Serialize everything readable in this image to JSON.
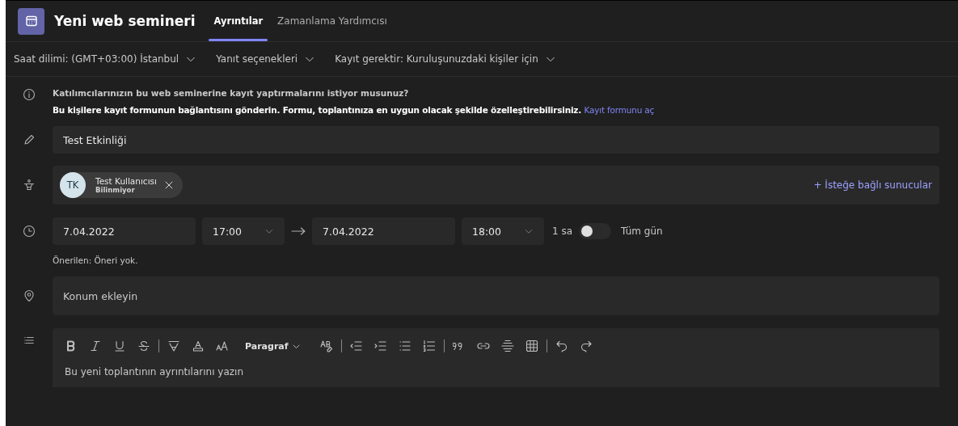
{
  "window": {
    "title": "Yeni web semineri"
  },
  "tabs": [
    {
      "label": "Ayrıntılar",
      "selected": true
    },
    {
      "label": "Zamanlama Yardımcısı",
      "selected": false
    }
  ],
  "options": [
    {
      "label": "Saat dilimi: (GMT+03:00) İstanbul"
    },
    {
      "label": "Yanıt seçenekleri"
    },
    {
      "label": "Kayıt gerektir: Kuruluşunuzdaki kişiler için"
    }
  ],
  "registration_notice": {
    "question": "Katılımcılarınızın bu web seminerine kayıt yaptırmalarını istiyor musunuz?",
    "description": "Bu kişilere kayıt formunun bağlantısını gönderin. Formu, toplantınıza en uygun olacak şekilde özelleştirebilirsiniz.",
    "link": "Kayıt formunu aç"
  },
  "title_field": {
    "value": "Test Etkinliği"
  },
  "presenters": [
    {
      "initials": "TK",
      "name": "Test Kullanıcısı",
      "status": "Bilinmiyor"
    }
  ],
  "optional_presenters_link": "+ İsteğe bağlı sunucular",
  "schedule": {
    "start_date": "7.04.2022",
    "start_time": "17:00",
    "end_date": "7.04.2022",
    "end_time": "18:00",
    "duration": "1 sa",
    "all_day": {
      "label": "Tüm gün",
      "on": false
    },
    "suggestion": "Önerilen: Öneri yok."
  },
  "location_field": {
    "placeholder": "Konum ekleyin"
  },
  "editor": {
    "toolbar": [
      {
        "kind": "bold"
      },
      {
        "kind": "italic"
      },
      {
        "kind": "underline"
      },
      {
        "kind": "strike"
      },
      {
        "kind": "separator"
      },
      {
        "kind": "highlight"
      },
      {
        "kind": "fontcolor"
      },
      {
        "kind": "fontsize"
      },
      {
        "kind": "dropdown",
        "label": "Paragraf"
      },
      {
        "kind": "clearformat"
      },
      {
        "kind": "separator"
      },
      {
        "kind": "outdent"
      },
      {
        "kind": "indent"
      },
      {
        "kind": "bullets"
      },
      {
        "kind": "numbering"
      },
      {
        "kind": "separator"
      },
      {
        "kind": "quote"
      },
      {
        "kind": "link"
      },
      {
        "kind": "hrule"
      },
      {
        "kind": "table"
      },
      {
        "kind": "separator"
      },
      {
        "kind": "undo"
      },
      {
        "kind": "redo"
      }
    ],
    "placeholder": "Bu yeni toplantının ayrıntılarını yazın"
  }
}
